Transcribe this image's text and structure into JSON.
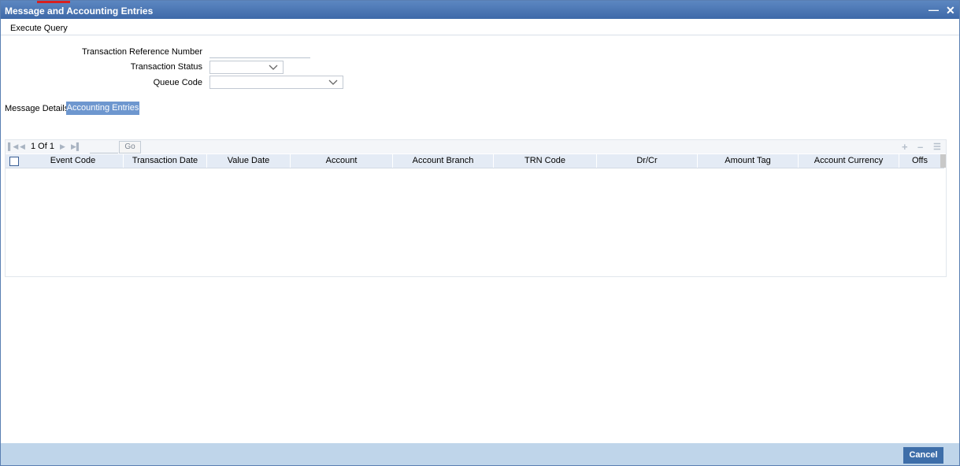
{
  "window": {
    "title": "Message and Accounting Entries"
  },
  "menu": {
    "execute_query": "Execute Query"
  },
  "form": {
    "trn_ref_label": "Transaction Reference Number",
    "trn_ref_value": "",
    "trn_status_label": "Transaction Status",
    "trn_status_value": "",
    "queue_code_label": "Queue Code",
    "queue_code_value": ""
  },
  "tabs": [
    {
      "label": "Message Details",
      "active": false
    },
    {
      "label": "Accounting Entries",
      "active": true
    }
  ],
  "grid": {
    "pager": {
      "page_text": "1 Of 1",
      "page_input": "",
      "go_label": "Go"
    },
    "columns": [
      "Event Code",
      "Transaction Date",
      "Value Date",
      "Account",
      "Account Branch",
      "TRN Code",
      "Dr/Cr",
      "Amount Tag",
      "Account Currency",
      "Offs"
    ],
    "rows": []
  },
  "footer": {
    "cancel_label": "Cancel"
  },
  "icons": [
    "first-page-icon",
    "prev-page-icon",
    "next-page-icon",
    "last-page-icon",
    "add-row-icon",
    "delete-row-icon",
    "single-view-icon",
    "minimize-icon",
    "close-icon",
    "chevron-down-icon"
  ],
  "colors": {
    "titlebar": "#4a76b2",
    "active_tab": "#6e97cf",
    "footer": "#bfd5ea",
    "cancel_button": "#3e6ea9",
    "grid_header": "#e4ebf5"
  }
}
